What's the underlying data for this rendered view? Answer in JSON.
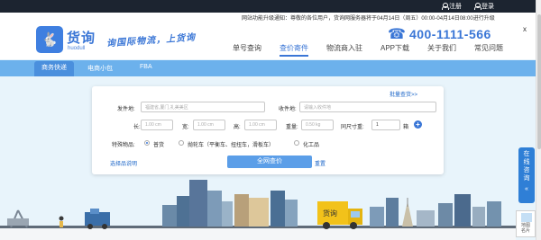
{
  "topbar": {
    "register": "注册",
    "login": "登录"
  },
  "notice": {
    "prefix": "网站功能升级通知：尊敬的各位用户，货询网服务器将于04月14日（周五）00:00-04月14日08:00进行升级",
    "link": ""
  },
  "header": {
    "logo_glyph": "🐇",
    "logo_name": "货询",
    "logo_sub": "huodull",
    "slogan": "询国际物流，上货询",
    "nav": [
      "单号查询",
      "查价寄件",
      "物流商入驻",
      "APP下载",
      "关于我们",
      "常见问题"
    ],
    "nav_active": 1,
    "phone": "400-1111-566",
    "close": "x"
  },
  "tabs": {
    "items": [
      "商务快递",
      "电商小包",
      "FBA"
    ],
    "active": 0
  },
  "form": {
    "bulk_query": "批量查货>>",
    "ship_from_label": "发件地:",
    "ship_from_placeholder": "福建省,厦门,礼美美区",
    "ship_to_label": "收件地:",
    "ship_to_placeholder": "请输入收件地",
    "length_label": "长:",
    "width_label": "宽:",
    "height_label": "高:",
    "dim_placeholder": "1.00",
    "dim_unit": "cm",
    "weight_label": "重量:",
    "weight_placeholder": "0.50",
    "weight_unit": "kg",
    "same_size_label": "同尺寸重:",
    "same_size_value": "1",
    "same_size_unit": "箱",
    "special_label": "特殊物品:",
    "special_options": [
      "普货",
      "",
      "化工品"
    ],
    "special_option_middle": "抛轮车（平衡车、扭扭车，滑板车）",
    "special_selected": 0,
    "help_link": "选择品说明",
    "search_button": "全网查价",
    "reset_link": "重置"
  },
  "side": {
    "consult": [
      "在",
      "线",
      "咨",
      "询"
    ],
    "chevron": "«",
    "map_line1": "地图",
    "map_line2": "名片"
  },
  "scene": {
    "truck_brand": "货询"
  },
  "colors": {
    "brand": "#3a76d6",
    "tabbar": "#6cb1ec",
    "topbar": "#1c2430",
    "button": "#5b9ee8"
  }
}
